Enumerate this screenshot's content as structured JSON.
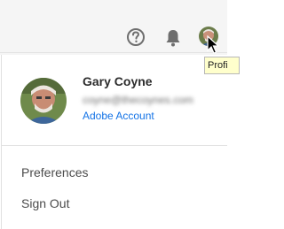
{
  "header": {
    "help_icon": "help-circle-icon",
    "notifications_icon": "bell-icon",
    "tooltip_text": "Profi"
  },
  "profile": {
    "name": "Gary Coyne",
    "email": "coyne@thecoynes.com",
    "account_link": "Adobe Account"
  },
  "menu": {
    "items": [
      {
        "label": "Preferences"
      },
      {
        "label": "Sign Out"
      }
    ]
  },
  "colors": {
    "link": "#1473e6",
    "tooltip_bg": "#ffffcc",
    "topbar_bg": "#f5f5f5"
  }
}
